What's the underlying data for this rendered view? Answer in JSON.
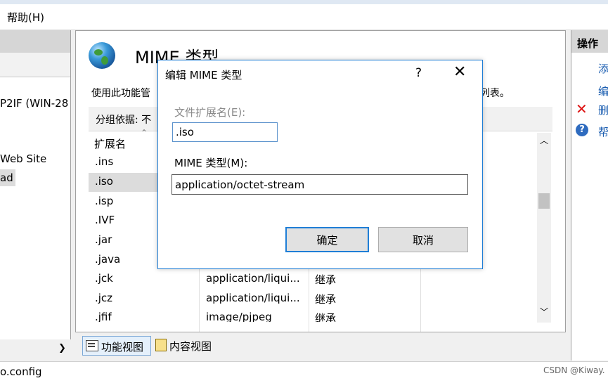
{
  "menubar": {
    "help": "帮助(H)"
  },
  "tree": {
    "server": "P2IF (WIN-28",
    "site": " Web Site",
    "app": "ad"
  },
  "feature": {
    "title": "MIME 类型",
    "description_start": "使用此功能管",
    "description_end": "列表。",
    "group_by_label": "分组依据:  不",
    "column_extension": "扩展名",
    "rows": [
      {
        "ext": ".ins",
        "type": "",
        "entry": ""
      },
      {
        "ext": ".iso",
        "type": "",
        "entry": ""
      },
      {
        "ext": ".isp",
        "type": "",
        "entry": ""
      },
      {
        "ext": ".IVF",
        "type": "",
        "entry": ""
      },
      {
        "ext": ".jar",
        "type": "",
        "entry": ""
      },
      {
        "ext": ".java",
        "type": "",
        "entry": ""
      },
      {
        "ext": ".jck",
        "type": "application/liqui...",
        "entry": "继承"
      },
      {
        "ext": ".jcz",
        "type": "application/liqui...",
        "entry": "继承"
      },
      {
        "ext": ".jfif",
        "type": "image/pjpeg",
        "entry": "继承"
      }
    ],
    "selected_row": 1
  },
  "views": {
    "feature_view": "功能视图",
    "content_view": "内容视图"
  },
  "actions": {
    "title": "操作",
    "add": "添",
    "edit": "编",
    "remove": "删",
    "help": "帮"
  },
  "status": {
    "text": "o.config",
    "watermark": "CSDN @Kiway."
  },
  "dialog": {
    "title": "编辑 MIME 类型",
    "help_glyph": "?",
    "close_glyph": "✕",
    "ext_label": "文件扩展名(E):",
    "ext_value": ".iso",
    "mime_label": "MIME 类型(M):",
    "mime_value": "application/octet-stream",
    "ok": "确定",
    "cancel": "取消"
  },
  "icons": {
    "globe": "globe-icon",
    "remove": "red-x-icon",
    "help": "question-circle-icon"
  }
}
